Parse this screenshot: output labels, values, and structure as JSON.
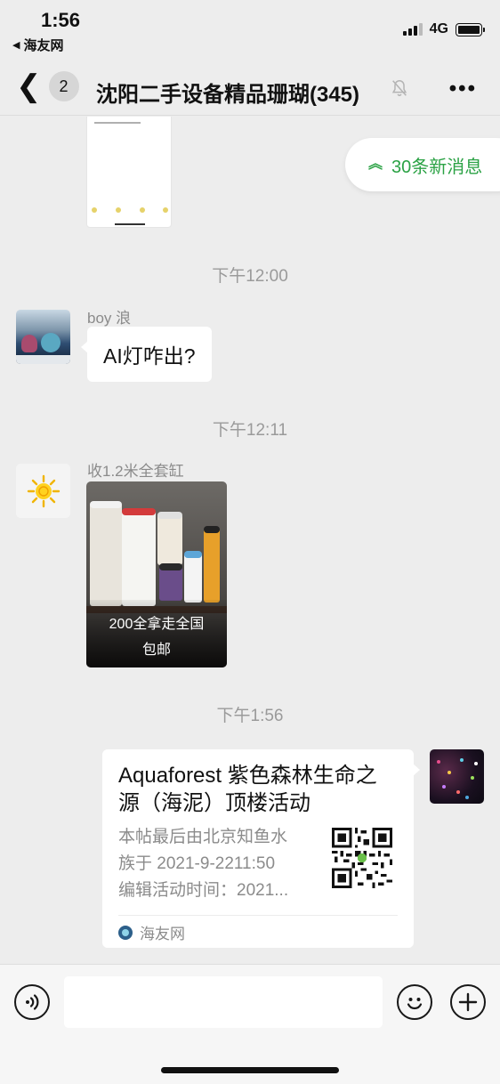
{
  "status_bar": {
    "time": "1:56",
    "back_app": "海友网",
    "network": "4G"
  },
  "nav": {
    "unread_count": "2",
    "title": "沈阳二手设备精品珊瑚(345)"
  },
  "new_messages_pill": "30条新消息",
  "messages": [
    {
      "timestamp": "下午12:00",
      "sender": "boy 浪",
      "text": "AI灯咋出?"
    },
    {
      "timestamp": "下午12:11",
      "sender": "收1.2米全套缸",
      "image_caption_line1": "200全拿走全国",
      "image_caption_line2": "包邮"
    },
    {
      "timestamp": "下午1:56",
      "card": {
        "title": "Aquaforest 紫色森林生命之源（海泥）顶楼活动",
        "desc_line1": "本帖最后由北京知鱼水",
        "desc_line2": "族于 2021-9-2211:50",
        "desc_line3": "编辑活动时间：2021...",
        "source": "海友网"
      }
    }
  ],
  "colors": {
    "accent_green": "#2ba245",
    "background": "#ededed",
    "timestamp_gray": "#9a9a9a"
  },
  "icons": [
    "back-chevron-icon",
    "mute-bell-icon",
    "more-icon",
    "voice-icon",
    "emoji-icon",
    "plus-icon",
    "double-chevron-up-icon",
    "sun-icon",
    "qr-code-icon",
    "site-logo-icon"
  ]
}
